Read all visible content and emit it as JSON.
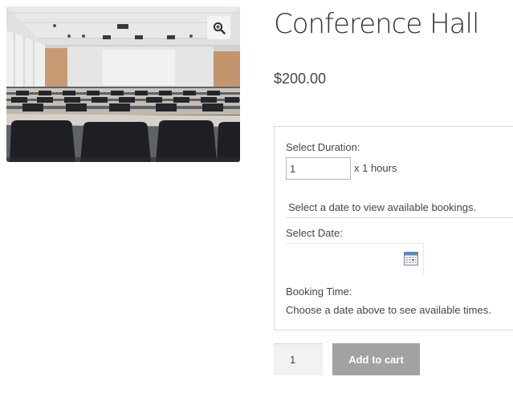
{
  "product": {
    "title": "Conference Hall",
    "price": "$200.00"
  },
  "icons": {
    "zoom": "magnifier-zoom-icon",
    "calendar": "calendar-icon"
  },
  "booking": {
    "duration_label": "Select Duration:",
    "duration_value": "1",
    "duration_unit": "x 1 hours",
    "availability_message": "Select a date to view available bookings.",
    "date_label": "Select Date:",
    "date_value": "",
    "time_label": "Booking Time:",
    "time_message": "Choose a date above to see available times."
  },
  "cart": {
    "quantity": "1",
    "add_to_cart_label": "Add to cart"
  },
  "colors": {
    "button": "#a2a2a2",
    "text": "#43454b",
    "title": "#333333"
  }
}
